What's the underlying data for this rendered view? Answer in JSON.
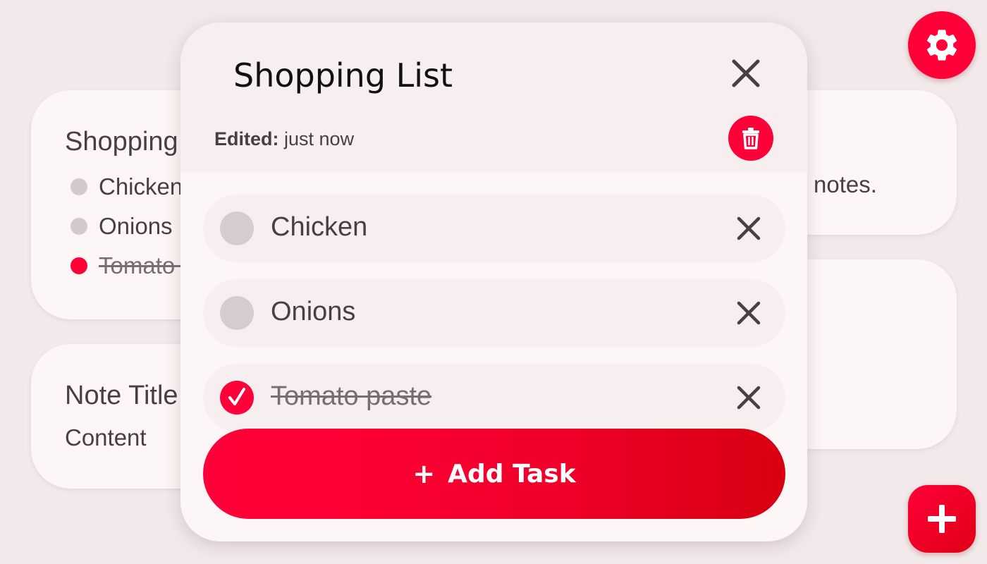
{
  "background_notes": {
    "shopping_card": {
      "title": "Shopping List",
      "items": [
        {
          "text": "Chicken",
          "checked": false
        },
        {
          "text": "Onions",
          "checked": false
        },
        {
          "text": "Tomato paste",
          "checked": true
        }
      ]
    },
    "note_card": {
      "title": "Note Title",
      "content": "Content"
    },
    "right_card_text": "notes."
  },
  "modal": {
    "title": "Shopping List",
    "edited_label": "Edited:",
    "edited_value": "just now",
    "tasks": [
      {
        "text": "Chicken",
        "checked": false
      },
      {
        "text": "Onions",
        "checked": false
      },
      {
        "text": "Tomato paste",
        "checked": true
      }
    ],
    "add_task_plus": "+",
    "add_task_label": "Add Task"
  },
  "icons": {
    "settings": "gear-icon",
    "add": "plus-icon",
    "close": "close-icon",
    "delete": "trash-icon",
    "check": "check-icon",
    "remove": "remove-icon"
  },
  "colors": {
    "accent": "#ff0038",
    "background": "#f2e9ea",
    "card": "#fdf6f6",
    "text": "#4a3e41"
  }
}
